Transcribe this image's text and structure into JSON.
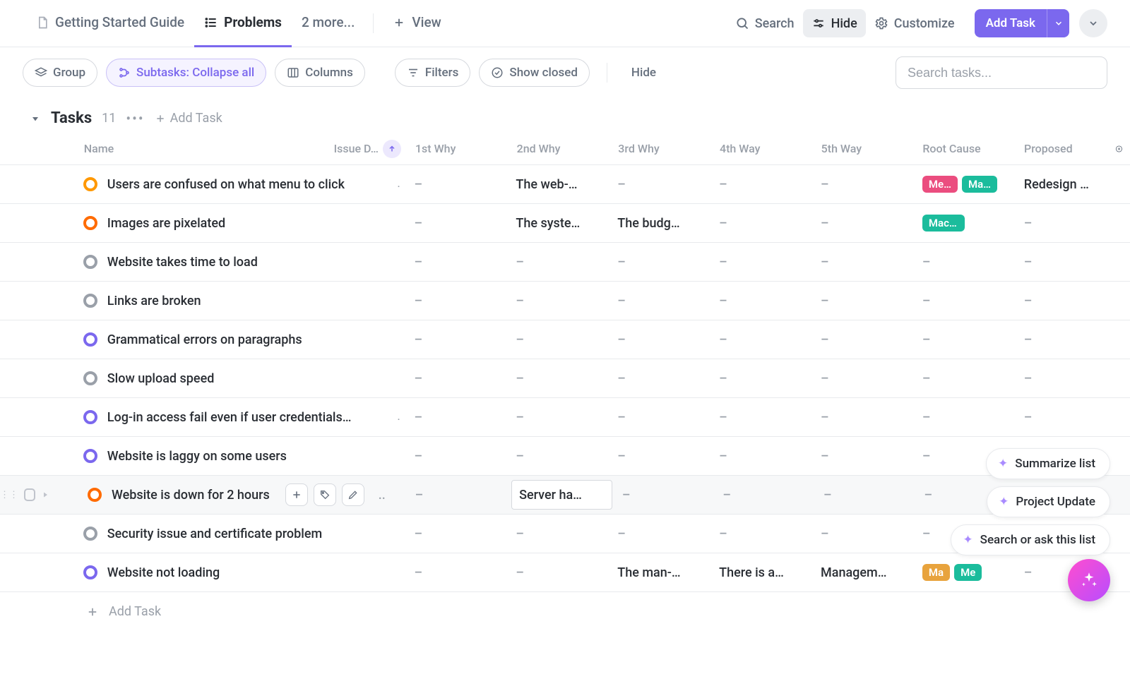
{
  "topbar": {
    "tabs": [
      {
        "icon": "doc-icon",
        "label": "Getting Started Guide"
      },
      {
        "icon": "list-icon",
        "label": "Problems"
      },
      {
        "icon": "",
        "label": "2 more..."
      }
    ],
    "view_label": "View",
    "search_label": "Search",
    "hide_label": "Hide",
    "customize_label": "Customize",
    "add_task_label": "Add Task"
  },
  "filterbar": {
    "group_label": "Group",
    "subtasks_label": "Subtasks: Collapse all",
    "columns_label": "Columns",
    "filters_label": "Filters",
    "show_closed_label": "Show closed",
    "hide_label": "Hide",
    "search_placeholder": "Search tasks..."
  },
  "section": {
    "title": "Tasks",
    "count": "11",
    "add_label": "Add Task"
  },
  "columns": {
    "name": "Name",
    "issue_date": "Issue D…",
    "why1": "1st Why",
    "why2": "2nd Why",
    "why3": "3rd Why",
    "why4": "4th Way",
    "why5": "5th Way",
    "root": "Root Cause",
    "proposed": "Proposed"
  },
  "rows": [
    {
      "status": "orange",
      "name": "Users are confused on what menu to click",
      "dot_after": ".",
      "why1": "",
      "why2": "The web-…",
      "why3": "–",
      "why4": "–",
      "why5": "–",
      "root": [
        {
          "text": "Me…",
          "color": "pink"
        },
        {
          "text": "Ma…",
          "color": "teal"
        }
      ],
      "proposed": "Redesign …"
    },
    {
      "status": "dkorange",
      "name": "Images are pixelated",
      "dot_after": "",
      "why1": "",
      "why2": "The syste…",
      "why3": "The budg…",
      "why4": "–",
      "why5": "–",
      "root": [
        {
          "text": "Machine",
          "color": "teal"
        }
      ],
      "proposed": "–"
    },
    {
      "status": "gray",
      "name": "Website takes time to load",
      "dot_after": "",
      "why1": "",
      "why2": "–",
      "why3": "–",
      "why4": "–",
      "why5": "–",
      "root": [],
      "proposed": "–"
    },
    {
      "status": "gray",
      "name": "Links are broken",
      "dot_after": "",
      "why1": "",
      "why2": "–",
      "why3": "–",
      "why4": "–",
      "why5": "–",
      "root": [],
      "proposed": "–"
    },
    {
      "status": "purple",
      "name": "Grammatical errors on paragraphs",
      "dot_after": "",
      "why1": "",
      "why2": "–",
      "why3": "–",
      "why4": "–",
      "why5": "–",
      "root": [],
      "proposed": "–"
    },
    {
      "status": "gray",
      "name": "Slow upload speed",
      "dot_after": "",
      "why1": "",
      "why2": "–",
      "why3": "–",
      "why4": "–",
      "why5": "–",
      "root": [],
      "proposed": "–"
    },
    {
      "status": "purple",
      "name": "Log-in access fail even if user credentials…",
      "dot_after": ".",
      "why1": "",
      "why2": "–",
      "why3": "–",
      "why4": "–",
      "why5": "–",
      "root": [],
      "proposed": "–"
    },
    {
      "status": "purple",
      "name": "Website is laggy on some users",
      "dot_after": "",
      "why1": "",
      "why2": "–",
      "why3": "–",
      "why4": "–",
      "why5": "–",
      "root": [],
      "proposed": "–"
    },
    {
      "status": "dkorange",
      "name": "Website is down for 2 hours",
      "dot_after": "..",
      "hovered": true,
      "why1": "",
      "why2": "Server ha…",
      "why3": "–",
      "why4": "–",
      "why5": "–",
      "root": [],
      "proposed": "–"
    },
    {
      "status": "gray",
      "name": "Security issue and certificate problem",
      "dot_after": "",
      "why1": "",
      "why2": "–",
      "why3": "–",
      "why4": "–",
      "why5": "–",
      "root": [],
      "proposed": "–"
    },
    {
      "status": "purple",
      "name": "Website not loading",
      "dot_after": "",
      "why1": "",
      "why2": "–",
      "why3": "The man-…",
      "why4": "There is a…",
      "why5": "Managem…",
      "root": [
        {
          "text": "Ma",
          "color": "amber"
        },
        {
          "text": "Me",
          "color": "teal"
        }
      ],
      "proposed": ""
    }
  ],
  "addrow_label": "Add Task",
  "ai": {
    "chip1": "Summarize list",
    "chip2": "Project Update",
    "chip3": "Search or ask this list"
  }
}
